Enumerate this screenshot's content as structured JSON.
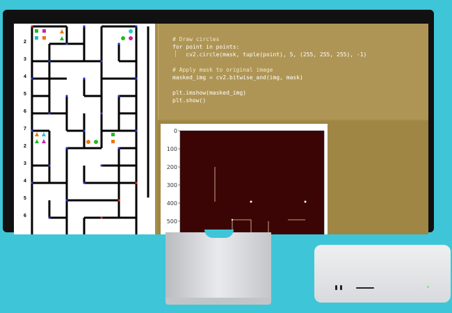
{
  "code_lines": [
    {
      "text": "# Draw circles",
      "kind": "comment"
    },
    {
      "text": "for point in points:",
      "kind": "code"
    },
    {
      "text": "    cv2.circle(mask, tuple(point), 5, (255, 255, 255), -1)",
      "kind": "code"
    },
    {
      "text": "",
      "kind": "blank"
    },
    {
      "text": "# Apply mask to original image",
      "kind": "comment"
    },
    {
      "text": "masked_img = cv2.bitwise_and(img, mask)",
      "kind": "code"
    },
    {
      "text": "",
      "kind": "blank"
    },
    {
      "text": "plt.imshow(masked_img)",
      "kind": "code"
    },
    {
      "text": "plt.show()",
      "kind": "code"
    }
  ],
  "maze_row_numbers": [
    "2",
    "3",
    "4",
    "5",
    "6",
    "7",
    "2",
    "3",
    "4",
    "5",
    "6"
  ],
  "plot_y_ticks": [
    "0",
    "100",
    "200",
    "300",
    "400",
    "500"
  ],
  "colors": {
    "screen_bg": "#a48c4a",
    "code_bg": "#af9555",
    "plot_bg": "#3b0505",
    "maze_wall": "#000000",
    "desktop_bg": "#3ec6d8"
  },
  "maze_icons": [
    "green-square",
    "magenta-square",
    "cyan-circle",
    "orange-triangle",
    "green-triangle",
    "cyan-square",
    "orange-square",
    "magenta-triangle",
    "orange-circle"
  ]
}
